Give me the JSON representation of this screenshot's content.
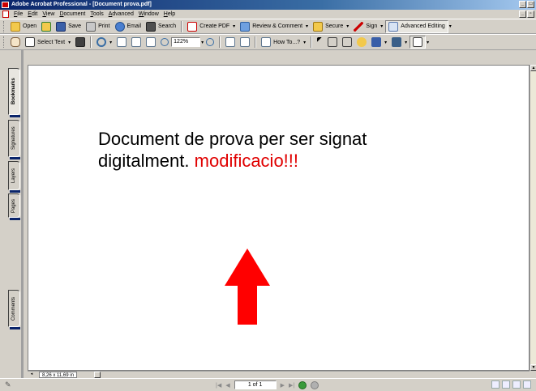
{
  "window": {
    "title": "Adobe Acrobat Professional - [Document prova.pdf]"
  },
  "menu": [
    "File",
    "Edit",
    "View",
    "Document",
    "Tools",
    "Advanced",
    "Window",
    "Help"
  ],
  "toolbar1": {
    "open": "Open",
    "save": "Save",
    "print": "Print",
    "email": "Email",
    "search": "Search",
    "create_pdf": "Create PDF",
    "review": "Review & Comment",
    "secure": "Secure",
    "sign": "Sign",
    "advanced_editing": "Advanced Editing"
  },
  "toolbar2": {
    "select_text": "Select Text",
    "zoom": "122%",
    "how_to": "How To...?"
  },
  "sidebar": {
    "tabs": [
      "Bookmarks",
      "Signatures",
      "Layers",
      "Pages",
      "Comments"
    ]
  },
  "document": {
    "line1": "Document de prova per ser signat",
    "line2_black": "digitalment.",
    "line2_red": "modificacio!!!"
  },
  "status": {
    "page_size": "8,26 x 11,69 in",
    "page_indicator": "1 of 1"
  },
  "colors": {
    "red_text": "#e00000",
    "arrow": "#ff0000",
    "title_bar": "#0a246a"
  }
}
